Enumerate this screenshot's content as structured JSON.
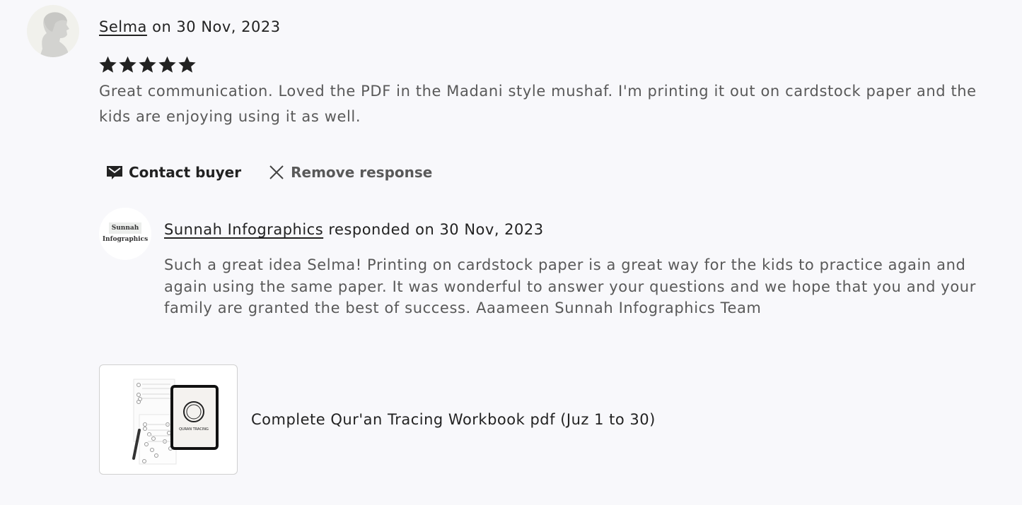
{
  "review": {
    "reviewer_name": "Selma",
    "date_text": " on 30 Nov, 2023",
    "rating": 5,
    "rating_max": 5,
    "text": "Great communication. Loved the PDF in the Madani style mushaf. I'm printing it out on cardstock paper and the kids are enjoying using it as well."
  },
  "actions": {
    "contact_label": "Contact buyer",
    "remove_label": "Remove response"
  },
  "response": {
    "shop_logo_line1": "Sunnah",
    "shop_logo_line2": "Infographics",
    "shop_name": "Sunnah Infographics",
    "date_text": " responded on 30 Nov, 2023",
    "text": "Such a great idea Selma! Printing on cardstock paper is a great way for the kids to practice again and again using the same paper. It was wonderful to answer your questions and we hope that you and your family are granted the best of success. Aaameen Sunnah Infographics Team"
  },
  "product": {
    "title": "Complete Qur'an Tracing Workbook pdf (Juz 1 to 30)",
    "image_caption": "QURAN TRACING"
  }
}
